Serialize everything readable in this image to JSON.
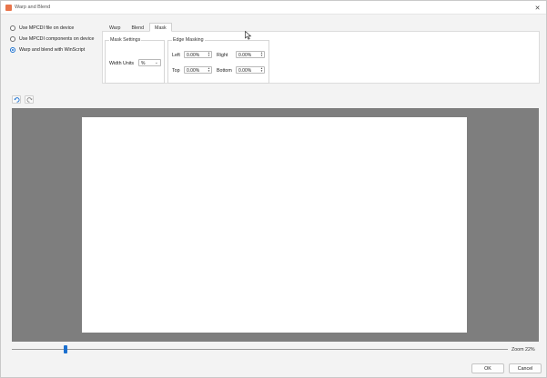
{
  "window": {
    "title": "Warp and Blend",
    "close_glyph": "✕"
  },
  "mode_options": [
    {
      "label": "Use MPCDI file on device",
      "checked": false
    },
    {
      "label": "Use MPCDI components on device",
      "checked": false
    },
    {
      "label": "Warp and blend with WinScript",
      "checked": true
    }
  ],
  "tabs": [
    {
      "label": "Warp",
      "active": false
    },
    {
      "label": "Blend",
      "active": false
    },
    {
      "label": "Mask",
      "active": true
    }
  ],
  "mask_settings": {
    "group_title": "Mask Settings",
    "width_units_label": "Width Units",
    "width_units_value": "%"
  },
  "edge_masking": {
    "group_title": "Edge Masking",
    "left": {
      "label": "Left",
      "value": "0.00%"
    },
    "right": {
      "label": "Right",
      "value": "0.00%"
    },
    "top": {
      "label": "Top",
      "value": "0.00%"
    },
    "bottom": {
      "label": "Bottom",
      "value": "0.00%"
    }
  },
  "zoom": {
    "label": "Zoom",
    "value": "22%"
  },
  "buttons": {
    "ok": "OK",
    "cancel": "Cancel"
  },
  "colors": {
    "accent": "#1a6fcf",
    "app_icon": "#e8744a",
    "preview_bg": "#7e7e7e"
  }
}
